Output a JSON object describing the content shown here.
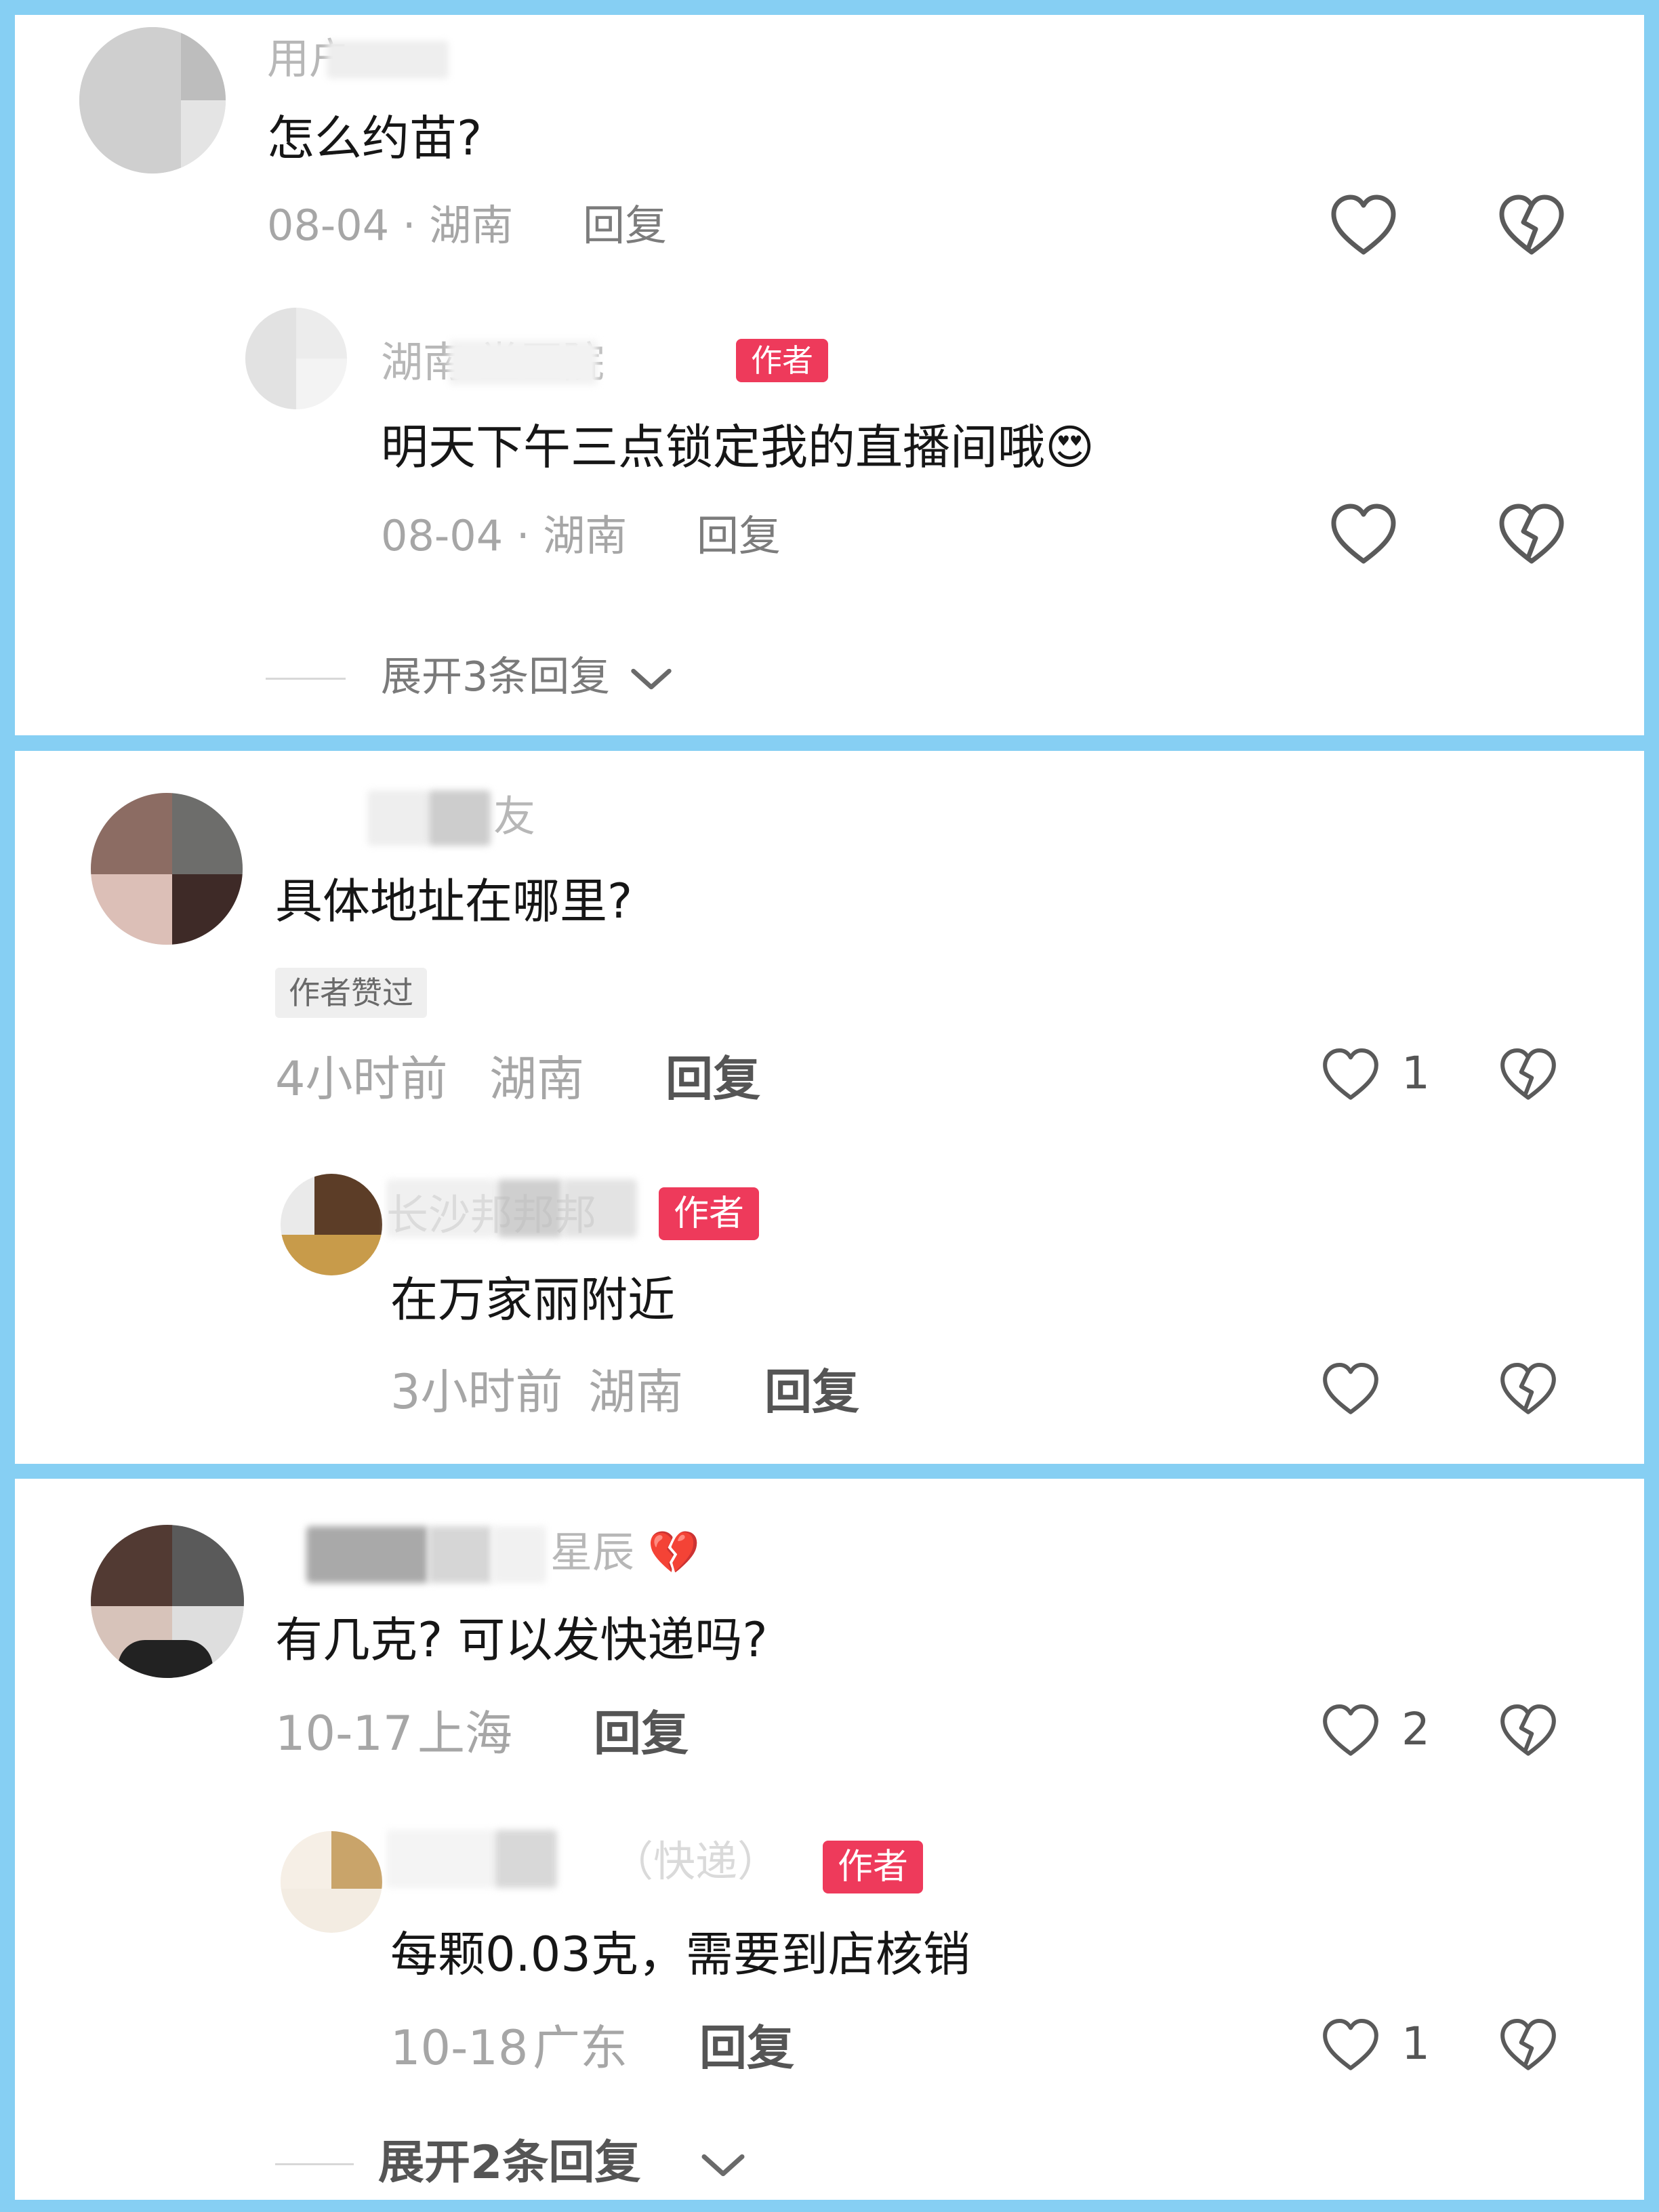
{
  "comments": [
    {
      "username": "用户",
      "text": "怎么约苗?",
      "date": "08-04 · 湖南",
      "reply_label": "回复",
      "reply": {
        "username": "湖南          堂医院",
        "badge": "作者",
        "text": "明天下午三点锁定我的直播间哦",
        "emoji": "😍",
        "date": "08-04 · 湖南",
        "reply_label": "回复"
      },
      "expand_label": "展开3条回复"
    },
    {
      "username": "友",
      "text": "具体地址在哪里?",
      "liked_badge": "作者赞过",
      "date": "4小时前",
      "location": "湖南",
      "reply_label": "回复",
      "like_count": "1",
      "reply": {
        "username": "长沙邦邦邦",
        "badge": "作者",
        "text": "在万家丽附近",
        "date": "3小时前",
        "location": "湖南",
        "reply_label": "回复"
      }
    },
    {
      "username": "星辰",
      "username_emoji": "💔",
      "text": "有几克?  可以发快递吗?",
      "date": "10-17",
      "location": "上海",
      "reply_label": "回复",
      "like_count": "2",
      "reply": {
        "username": "（快递）",
        "badge": "作者",
        "text": "每颗0.03克，需要到店核销",
        "date": "10-18",
        "location": "广东",
        "reply_label": "回复",
        "like_count": "1"
      },
      "expand_label": "展开2条回复"
    }
  ],
  "icons": {
    "like": "heart-outline-icon",
    "dislike": "broken-heart-icon",
    "expand": "chevron-down-icon"
  },
  "colors": {
    "background": "#86cff3",
    "author_badge": "#ee3a5b"
  }
}
